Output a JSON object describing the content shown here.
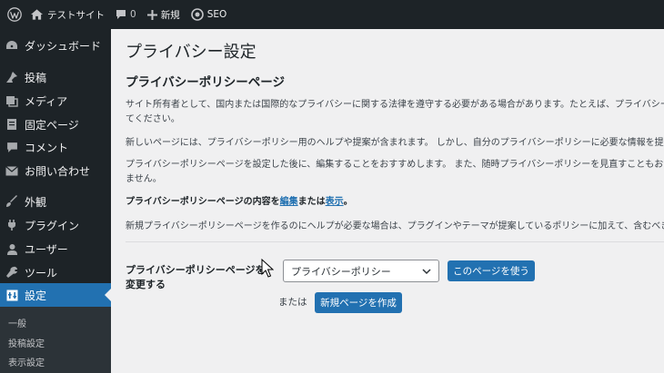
{
  "admin_bar": {
    "wp_logo": "wordpress-logo-icon",
    "site_name": "テストサイト",
    "comments_count": "0",
    "new_label": "新規",
    "seo_label": "SEO"
  },
  "sidebar": {
    "items": [
      {
        "label": "ダッシュボード",
        "icon": "dashboard-icon"
      },
      {
        "label": "投稿",
        "icon": "pin-icon"
      },
      {
        "label": "メディア",
        "icon": "media-icon"
      },
      {
        "label": "固定ページ",
        "icon": "page-icon"
      },
      {
        "label": "コメント",
        "icon": "comment-icon"
      },
      {
        "label": "お問い合わせ",
        "icon": "mail-icon"
      },
      {
        "label": "外観",
        "icon": "brush-icon"
      },
      {
        "label": "プラグイン",
        "icon": "plugin-icon"
      },
      {
        "label": "ユーザー",
        "icon": "user-icon"
      },
      {
        "label": "ツール",
        "icon": "wrench-icon"
      },
      {
        "label": "設定",
        "icon": "settings-icon"
      }
    ],
    "submenu": [
      {
        "label": "一般"
      },
      {
        "label": "投稿設定"
      },
      {
        "label": "表示設定"
      }
    ]
  },
  "main": {
    "page_title": "プライバシー設定",
    "section_title": "プライバシーポリシーページ",
    "paragraphs": [
      "サイト所有者として、国内または国際的なプライバシーに関する法律を遵守する必要がある場合があります。たとえば、プライバシー",
      "てください。",
      "新しいページには、プライバシーポリシー用のヘルプや提案が含まれます。 しかし、自分のプライバシーポリシーに必要な情報を提供",
      "プライバシーポリシーページを設定した後に、編集することをおすすめします。 また、随時プライバシーポリシーを見直すこともおす",
      "ません。"
    ],
    "content_line": {
      "prefix": "プライバシーポリシーページの内容を",
      "edit_link": "編集",
      "middle": "または",
      "view_link": "表示",
      "suffix": "。"
    },
    "help_text": "新規プライバシーポリシーページを作るのにヘルプが必要な場合は、プラグインやテーマが提案しているポリシーに加えて、含むべき",
    "change_label": "プライバシーポリシーページを変更する",
    "select_value": "プライバシーポリシー",
    "use_page_button": "このページを使う",
    "or_text": "または",
    "create_new_button": "新規ページを作成"
  }
}
